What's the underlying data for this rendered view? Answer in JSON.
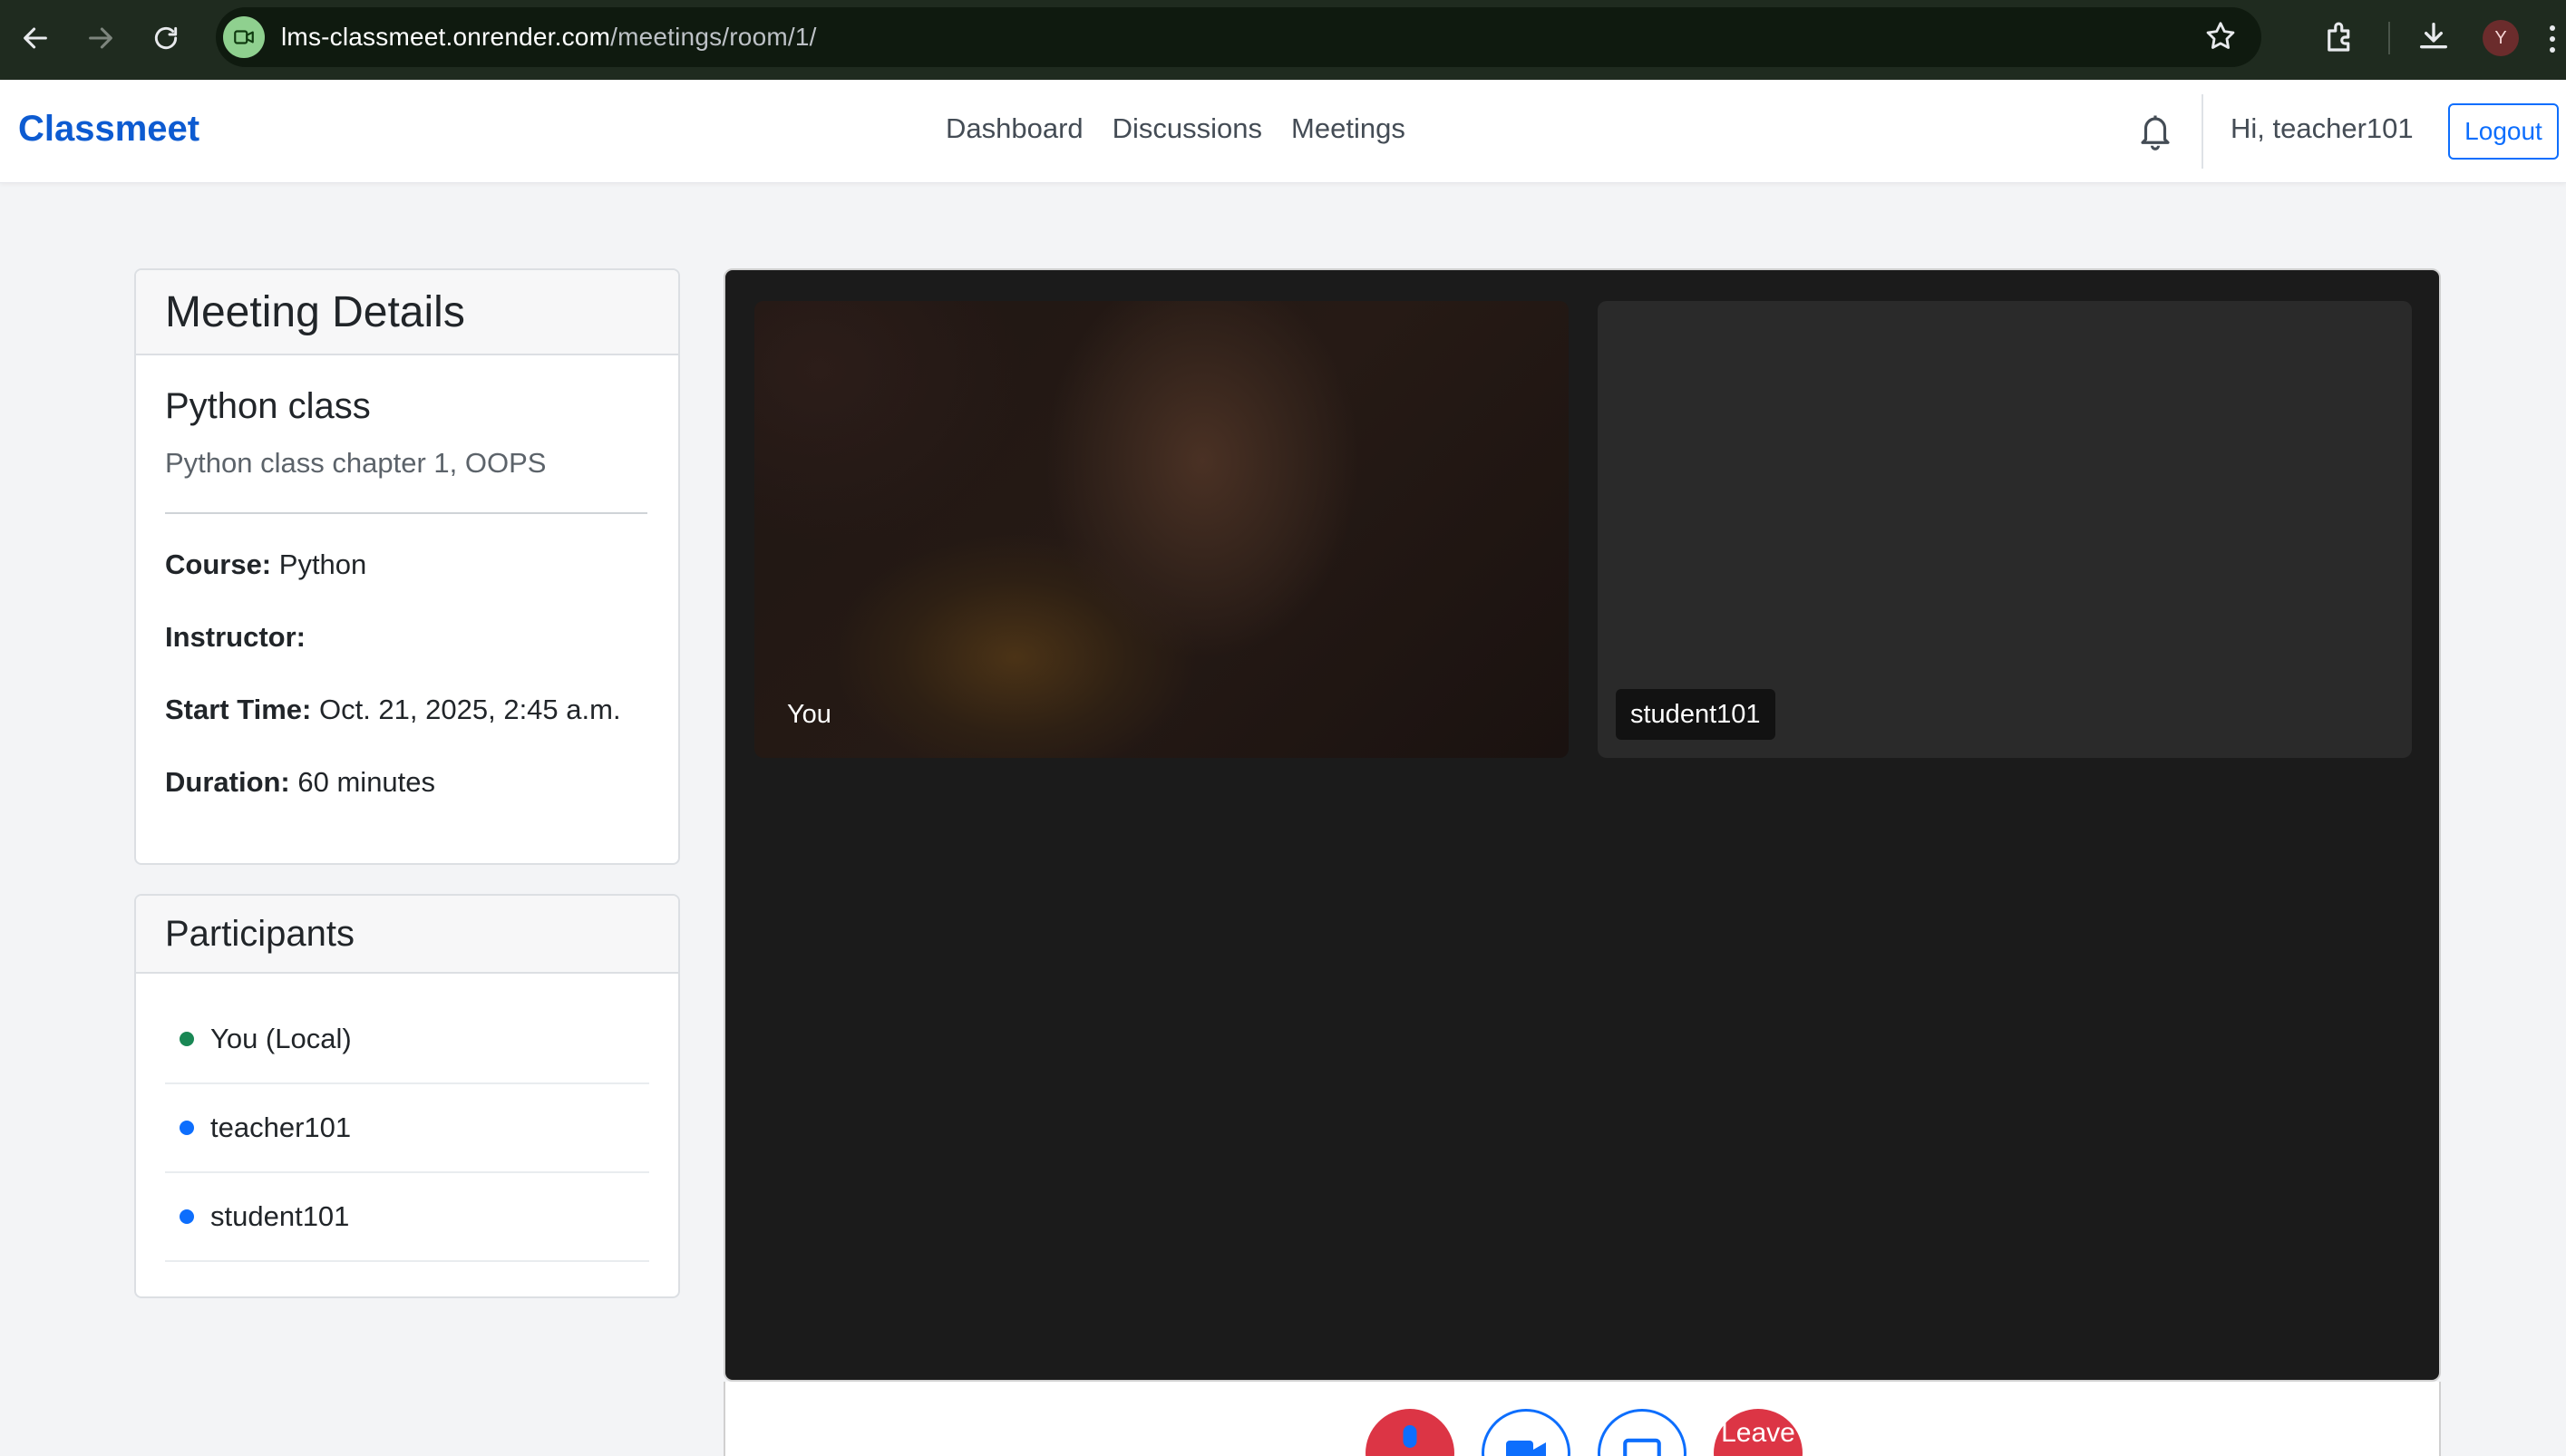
{
  "browser": {
    "url_host": "lms-classmeet.onrender.com",
    "url_path": "/meetings/room/1/",
    "profile_initial": "Y"
  },
  "navbar": {
    "brand": "Classmeet",
    "links": [
      "Dashboard",
      "Discussions",
      "Meetings"
    ],
    "greeting": "Hi, teacher101",
    "logout": "Logout"
  },
  "details": {
    "header": "Meeting Details",
    "title": "Python class",
    "description": "Python class chapter 1, OOPS",
    "course_label": "Course:",
    "course_value": "Python",
    "instructor_label": "Instructor:",
    "instructor_value": "",
    "start_label": "Start Time:",
    "start_value": "Oct. 21, 2025, 2:45 a.m.",
    "duration_label": "Duration:",
    "duration_value": "60 minutes"
  },
  "participants": {
    "header": "Participants",
    "items": [
      {
        "name": "You (Local)",
        "color": "#198754"
      },
      {
        "name": "teacher101",
        "color": "#0d6efd"
      },
      {
        "name": "student101",
        "color": "#0d6efd"
      }
    ]
  },
  "video": {
    "local_label": "You",
    "remote_label": "student101"
  },
  "controls": {
    "leave": "Leave"
  },
  "colors": {
    "brand": "#0d5bd1",
    "primary": "#0d6efd",
    "danger": "#dc3545",
    "stage": "#1b1b1b"
  }
}
